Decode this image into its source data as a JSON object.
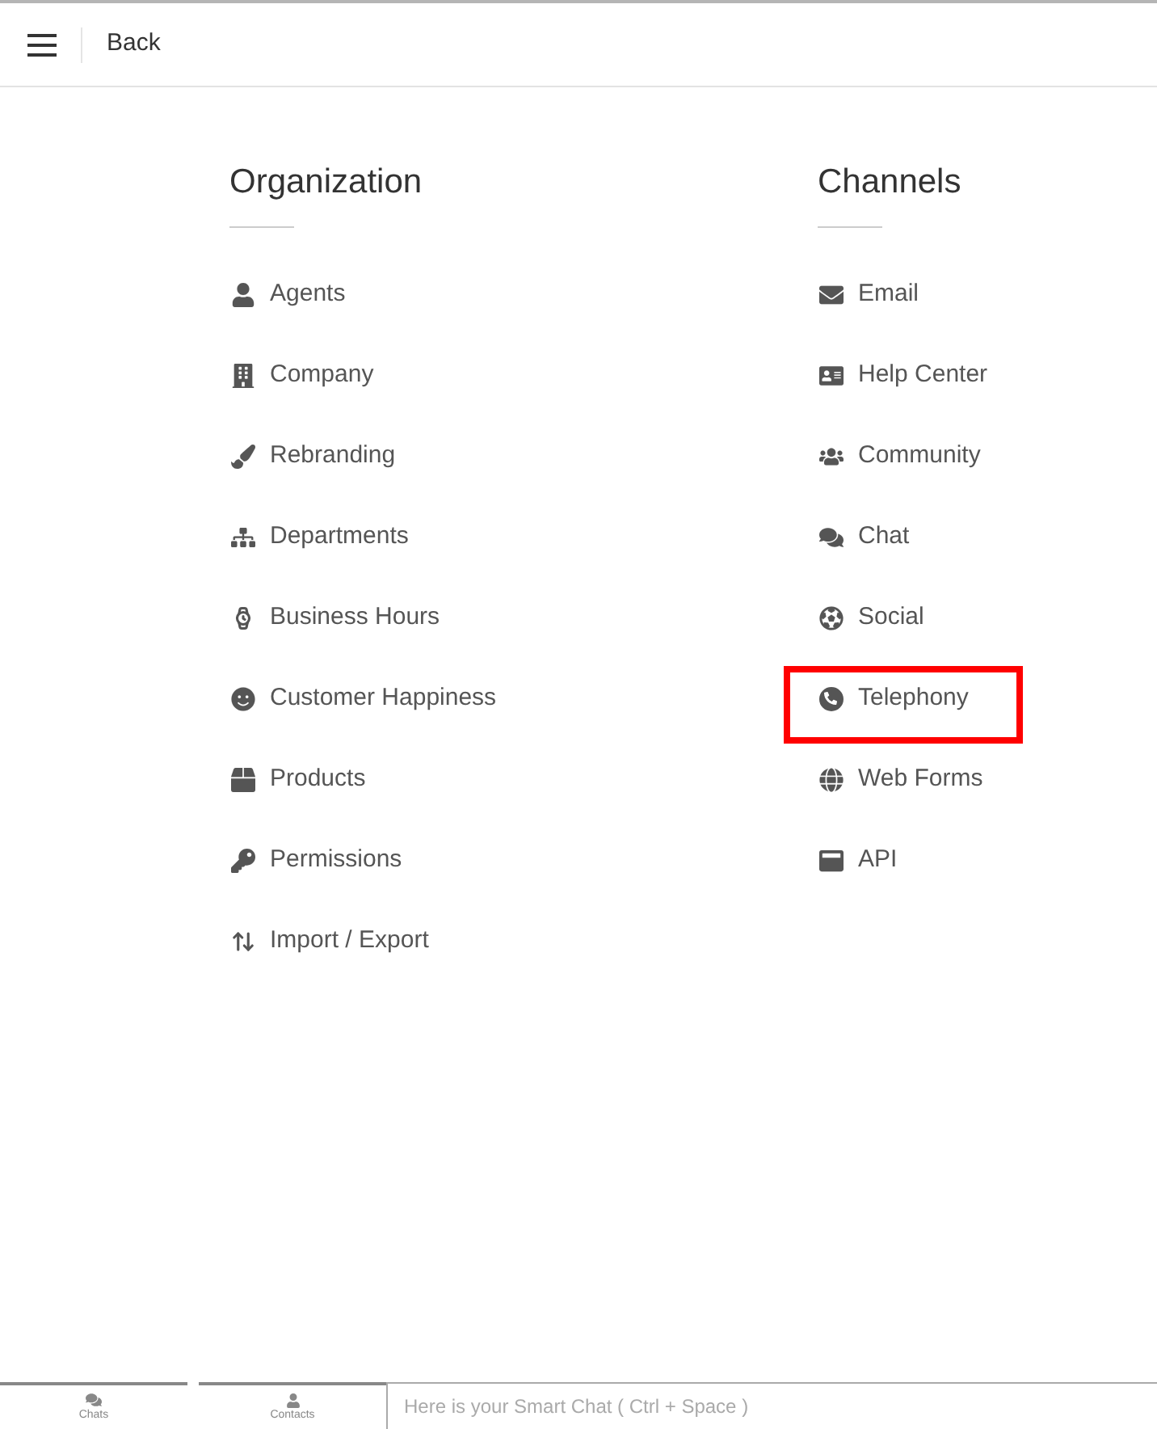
{
  "header": {
    "back": "Back"
  },
  "sections": [
    {
      "title": "Organization",
      "items": [
        {
          "label": "Agents",
          "highlighted": false
        },
        {
          "label": "Company",
          "highlighted": false
        },
        {
          "label": "Rebranding",
          "highlighted": false
        },
        {
          "label": "Departments",
          "highlighted": false
        },
        {
          "label": "Business Hours",
          "highlighted": false
        },
        {
          "label": "Customer Happiness",
          "highlighted": false
        },
        {
          "label": "Products",
          "highlighted": false
        },
        {
          "label": "Permissions",
          "highlighted": false
        },
        {
          "label": "Import / Export",
          "highlighted": false
        }
      ]
    },
    {
      "title": "Channels",
      "items": [
        {
          "label": "Email",
          "highlighted": false
        },
        {
          "label": "Help Center",
          "highlighted": false
        },
        {
          "label": "Community",
          "highlighted": false
        },
        {
          "label": "Chat",
          "highlighted": false
        },
        {
          "label": "Social",
          "highlighted": false
        },
        {
          "label": "Telephony",
          "highlighted": true
        },
        {
          "label": "Web Forms",
          "highlighted": false
        },
        {
          "label": "API",
          "highlighted": false
        }
      ]
    }
  ],
  "bottom_bar": {
    "tabs": [
      {
        "label": "Chats"
      },
      {
        "label": "Contacts"
      }
    ],
    "chat_input": {
      "placeholder": "Here is your Smart Chat ( Ctrl + Space )"
    }
  }
}
